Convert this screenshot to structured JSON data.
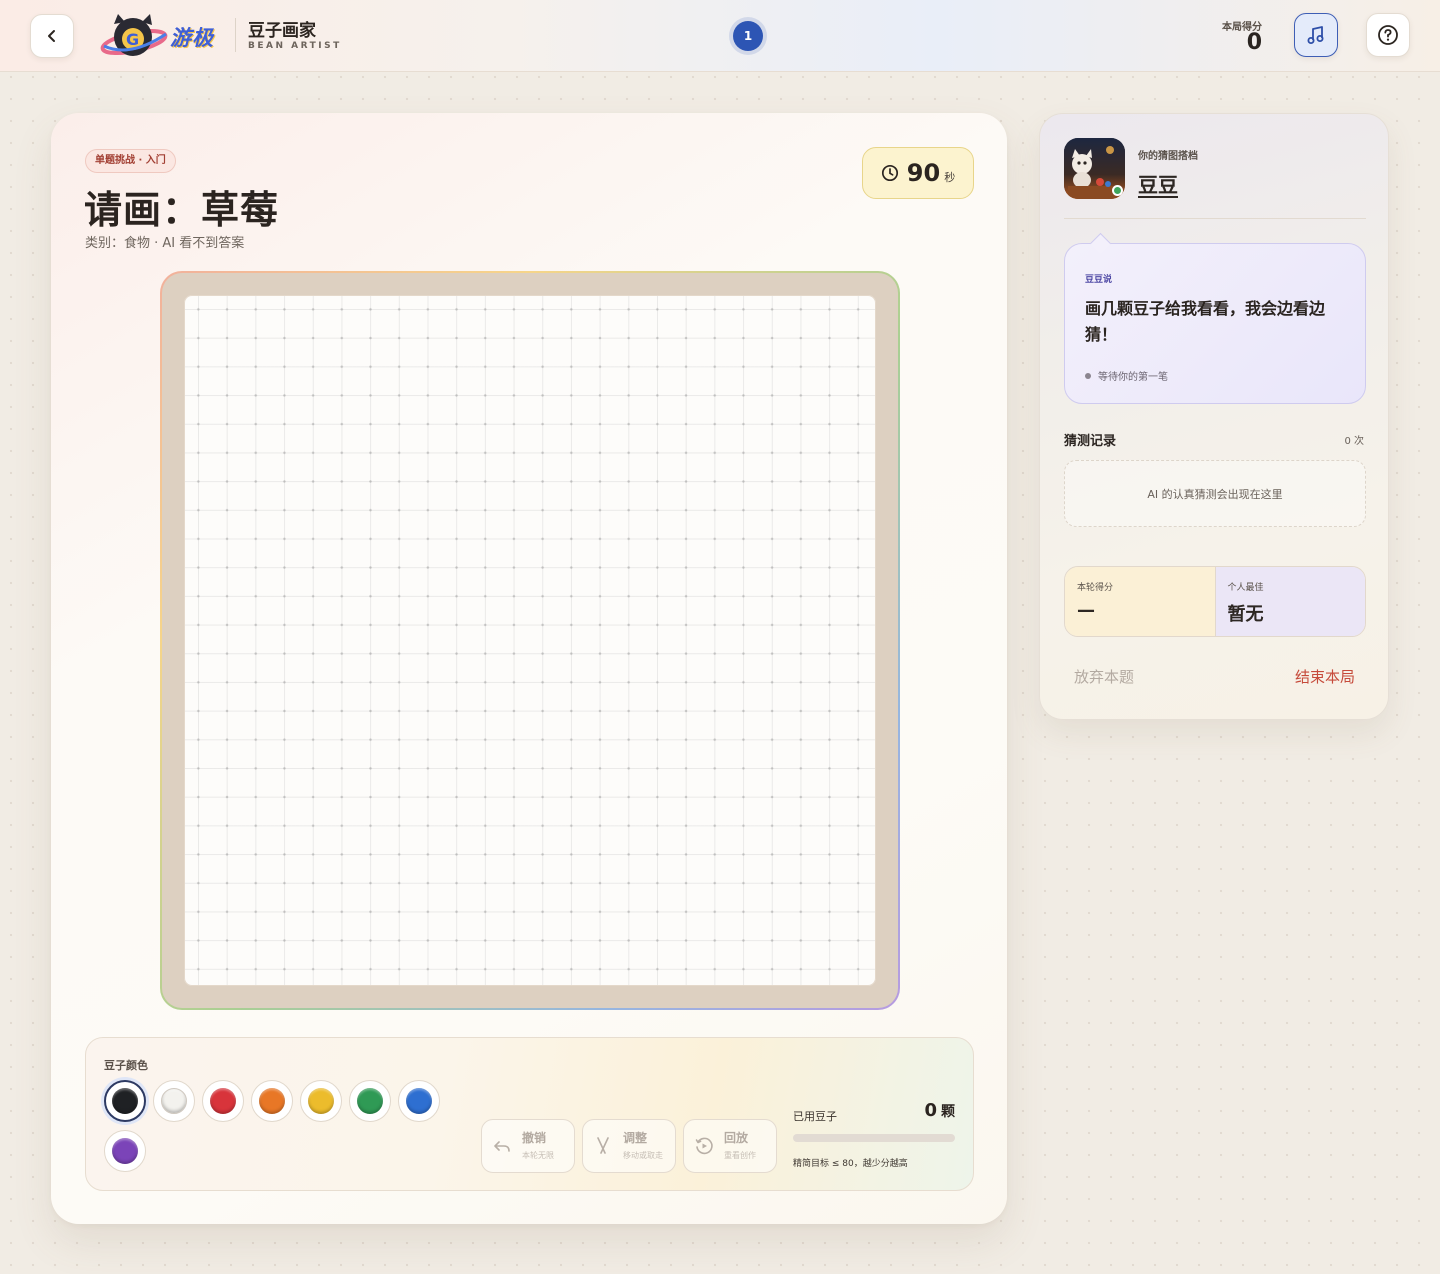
{
  "header": {
    "logo_text": "游极",
    "app_title": "豆子画家",
    "app_subtitle": "BEAN ARTIST",
    "round": "1",
    "score_label": "本局得分",
    "score_value": "0",
    "icons": {
      "back": "chevron-left-icon",
      "music": "music-note-icon",
      "help": "question-circle-icon"
    }
  },
  "challenge": {
    "tag": "单题挑战 · 入门",
    "title": "请画：草莓",
    "meta": "类别：食物 · AI 看不到答案",
    "timer_value": "90",
    "timer_unit": "秒"
  },
  "toolbar": {
    "colors_label": "豆子颜色",
    "colors": [
      {
        "name": "black",
        "hex": "#1f2124",
        "selected": true
      },
      {
        "name": "white",
        "hex": "#f3f2ee",
        "selected": false
      },
      {
        "name": "red",
        "hex": "#d8343b",
        "selected": false
      },
      {
        "name": "orange",
        "hex": "#e87726",
        "selected": false
      },
      {
        "name": "yellow",
        "hex": "#ecbc2c",
        "selected": false
      },
      {
        "name": "green",
        "hex": "#2f9a55",
        "selected": false
      },
      {
        "name": "blue",
        "hex": "#2e6fd1",
        "selected": false
      },
      {
        "name": "purple",
        "hex": "#7b44b8",
        "selected": false
      }
    ],
    "actions": [
      {
        "title": "撤销",
        "sub": "本轮无限",
        "icon": "undo-icon"
      },
      {
        "title": "调整",
        "sub": "移动或取走",
        "icon": "tweezers-icon"
      },
      {
        "title": "回放",
        "sub": "重看创作",
        "icon": "replay-icon"
      }
    ],
    "beans_label": "已用豆子",
    "beans_count": "0",
    "beans_unit": "颗",
    "beans_progress": 0,
    "beans_hint": "精简目标 ≤ 80，越少分越高"
  },
  "side": {
    "partner_label": "你的猜图搭档",
    "partner_name": "豆豆",
    "bubble_label": "豆豆说",
    "bubble_msg": "画几颗豆子给我看看，我会边看边猜！",
    "bubble_status": "等待你的第一笔",
    "history_title": "猜测记录",
    "history_count": "0 次",
    "history_empty": "AI 的认真猜测会出现在这里",
    "round_score_label": "本轮得分",
    "round_score_value": "—",
    "best_label": "个人最佳",
    "best_value": "暂无",
    "skip_label": "放弃本题",
    "end_label": "结束本局"
  }
}
